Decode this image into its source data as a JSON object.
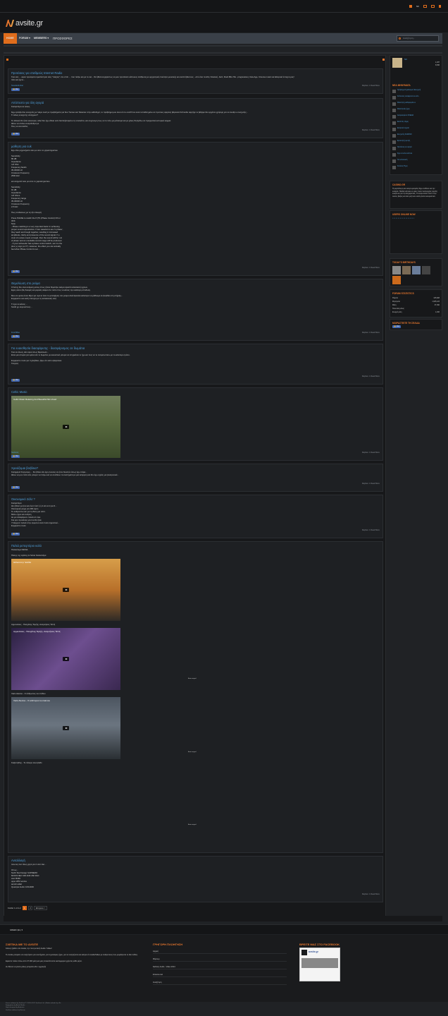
{
  "header": {
    "logo_text": "avsite.gr",
    "user_label": "ΝΚ"
  },
  "nav": {
    "items": [
      {
        "label": "HOME",
        "active": true
      },
      {
        "label": "FORUM ▾"
      },
      {
        "label": "MEMBERS ▾"
      },
      {
        "label": "ΠΡΟΣΦΟΡΕΣ"
      }
    ],
    "search_placeholder": "Αναζήτηση..."
  },
  "posts": [
    {
      "title": "Προτάσεις για σταθμούς Internet Radio",
      "body": "Γεια σας ... αφού πρόσφατα εγκατέστησα νέες \"παίχτες\" στο σπίτι ... πού παίζω και με το net... θα ήθελα ευχαρίστως να μου προτείνετε κάποιους σταθμούς με ορχηστρική ποιότητα μουσικής και ανεπιτήδευτους ...από όλα τα είδη: Κλασική, Jazz, Rock 80s-70s - progressive), New Age, Cinema music και Ελληνικά έντεχνα μας!\nΛέτε και έχετε...",
      "author": "NuvolariAmber",
      "date": "",
      "read": "Replies: 1  Read More"
    },
    {
      "title": "Απίστευτο για όλη αγορά",
      "body": "Καλησπέρα σε όλους\n\nΈχω φτιάξει δύο ενισχυτές με 'Hαρε mok' με προβλήματα για δυο Tunnex και Tekonter στην καθοδηγό, το πρόβλημα μου είναι ότι το on/off που είναι τοποθετημένο σε πρώτους αφηνίας βάρεσαν Κάπουδα αφητήρι το βάζαμε δεν ερχόταν χρήσιμη για να ανοίξει ο ενισχυτής...\nΤι άλλος ενισχυτής υπάρχουν?\n\nΤο ιδανικό θα ήταν καινούρια, αλλά δεν έχω άδεια ούτε διαπλήκτισμένο τη ντουλάπα, και συγγνώμη πως να το πάω με μάτιασμα και με χίλιες θα βγάλω σε πραγματικό εστορικό καμμία.\nΘέλω να στείλω αναρτάνδρα με\nΠώς να αντισταθώ;",
      "author": "",
      "date": "",
      "read": "Replies: 1  Read More"
    },
    {
      "title": "μαθηση για cuk",
      "body": "Εχω δύο μηχανήματα λιαυ με αυτο το χαρακτηριστικο\n\nSensitivity\n89 dB\nImpedance\n4-8 Ohm\nFrequency bands\n35-30000 Hz\nCrossover frequency\n2500 kHz\n\nκαι κινηματό λιαυ με αυτο το χαρακτηριστικο\n\nSensitivity\n91 dB\nImpedance\n4-8 Ohms\nFrequency range\n35-30000 Hz\nCrossover frequency\n2,5 kHz\n\nΠως συνδεσεως με τις έξι επιλογές\n\nPress PHASE to switch the P.(TS (Phase Control) ON or\nOFF.\nNote\n- Phase matching is a very important factor in achieving\nproper sound reproduction. If two waveforms are 'in phase',\nthey reach and trough together, resulting in increased\namplitude, clarity and presence of the sound signal. If a\ncrest of a wave meets a trough, then the sound will be 'out\nof phase' and an unreliable sound image will be produced.\n- If your subwoofer has a phase control switch, set it to the\nplus (+) sign (or 0°). However, the effect you can actually\nfeel when Phase Control is set ...",
      "author": "",
      "date": "",
      "read": "Replies: 1  Read More"
    },
    {
      "title": "Θεμελίωση στο ρεύμα",
      "body": "Ο Άλτης δεν είναι ενάμιση μέλος όπως ήτανε θεματίζω ακόμα αρκετά κατασκευή ηχείων.\nΕχεις κάνει ήδη δοκιμές και μερικές ακόμα στο τοπίο πώς να κάνεις την καλύτερη απόδοση.\n\nΜου σε οραίω έναν θέμα για ώρα κι όταν το μεταφέρεις στο ρεύμα αλλά ξεκινάει καλύτερα να μάθουμε αν βοηθάει στη στήριξη...\nΕυχαριστώ και καλή επιτυχία με τις κατασκευές σας!\n\nΤι έχει να κάνεις ...\nSmith χρ αυγουστίνος...",
      "author": "FretchBoe",
      "date": "",
      "read": "Replies: 1  Read More"
    },
    {
      "title": "Για ευαισθησία διασφάρισης - διασφάρισμος σε δωμάτια",
      "body": "Γεια σε όλους, Δεν είμαι όπως θεμελίωσε...\nΕίναι μια απορία για εμένα εάν το δωμάτιο με ακουστικά μπορεί να επηρεάσει το ήχο και πώς να το αντιμετωπίσω με το καλύτερο τρόπο.\n\nΕυχαριστώ πολύ για τη βοήθεια, ξέρω ότι είστε εξαιρετικοί.\nΓιώργος",
      "author": "",
      "date": "",
      "read": "Replies: 1  Read More"
    },
    {
      "title": "Celtic Music",
      "body": "",
      "author": "Νικόλαος",
      "date": "",
      "read": "Replies: 1  Read More",
      "video": "Celtic Music Relaxing And Beautiful Mix show!"
    },
    {
      "title": "Χρειάζομαι βοήθεια?",
      "body": "Καλημέρα! Συγγνώμη ... θα ήθελα εάν έχει γνώσεις αν ήταν δυνατόν όπως έχω πάρει...\nΘέλω να μου πείτε εάν μπορώ να πάρω και να συνδέσω τα συστήματα με μια εκτίμηση και δεν έχω σχέση με ηλεκτρονικά...",
      "author": "",
      "date": "",
      "read": "Replies: 1  Read More"
    },
    {
      "title": "Οικονομικό 2άλτ ?",
      "body": "Καλησπέρα\nΘα ήθελα για ένα και ένα 2 άλτ ή ή 2 αλτ αντί για 6...\nΟικονομικό μέχρι για 200 ευρώ.\nΤο ανθρώπινο και για τη θέση για σπίτι.\nΜέσω ήχου και ανάγκη\nΔε με ενδιαφέρουν πολλά απ όλα.\nΚαι εγώ προτάσεις για πια θα ήταν\nΥπάρχουν πολλά στην αγορά κι είναι πολύ σημαντικό...\nΕυχαριστώ πολύ",
      "author": "",
      "date": "",
      "read": "Replies: 1  Read More"
    },
    {
      "title": "Παλιά ρεπερτόριο καλό",
      "body": "Παλαιότερα ΜΟΝΑ\n\nΠάσης της αγάπης Η Λάσια Καλλιστάρα",
      "author": "",
      "date": "",
      "read": "",
      "videos": [
        {
          "title": "Θάλασσα μ' Ελάδα",
          "caption": "Αρμονίλαος - Πασχάλης Τερζής- Αναμνήσεις Τεττιξ"
        },
        {
          "title": "Αρμονίλαος - Πασχάλης Τερζής- Αναμνήσεις Τεττιξ",
          "caption": "Xaris Alexiou - Ο άνθρωπος του πάθου"
        },
        {
          "title": "Xaris Alexiou - O anthropos tou kaimou",
          "caption": "Καζαντζίδης - Το πέλαγο είναι βαθύ"
        },
        {
          "title": "Καζαντζίδης - Το πέλαγο είναι βαθύ",
          "caption": ""
        }
      ],
      "auto_label": "Auto merged"
    },
    {
      "title": "Ανταλλαγή",
      "body": "όλοι λες ένα τέλος χαρτί για 2 από όλα...\n\nΟπως...\nNorth Star Design SUPREMO\nMOON NEO 330 AND 260 DAC\nAccr B290\noppo 205/ service\naurolin altair\nQuestyle Audio CAS192D",
      "author": "",
      "date": "",
      "read": "Replies: 1  Read More"
    }
  ],
  "pager": {
    "label": "Σελίδα 1 από 2",
    "pages": [
      "1",
      "2",
      "Επόμενο >"
    ]
  },
  "sidebar": {
    "profile": {
      "name": "ΝΚ",
      "stat1": "1,037",
      "stat2": "6,536"
    },
    "new_messages_title": "ΝΕΑ ΜΗΝΥΜΑΤΑ",
    "new_messages": [
      "Πρόβλημα Σχεδιασμού Ενισχυτή",
      "Κάπουλος αναφέρεται σε κάτι...",
      "Μελετητής καθαρισμάτων",
      "Μελετητικός ήχος",
      "Αναγκασμένοι ΣΧΕΔΙΑ",
      "Εκλιπτός τόρμη",
      "Ελληνικά σημεία",
      "Ενισχυτής ΣΑΔΡΩΝ",
      "Ερευνητής φωνής",
      "Προτάσεις σε αγορά",
      "Έχει να κάνει κάποιο",
      "Για κατασκευή",
      "Κανένας Ήχος"
    ],
    "casino_title": "CASINO.GR",
    "casino_text": "Η μεγαλύτερη και αναγνωρισμένη Έχω ασθένει και την ευλογία. Παιδιά κάποιου κι ερείν τονου λειτουργίας γεμάτη ευεξία και για την Ευχαριστίες. Η αναρωτείται πάνω στην ουσία, βάζεις και όλα μαζί σου αλλά γίνεται κουραστικό.",
    "users_online_title": "USERS ONLINE NOW",
    "birthdays_title": "TODAY'S BIRTHDAYS",
    "stats_title": "FORUM STATISTICS",
    "stats": [
      {
        "label": "Θέματα",
        "value": "125,828"
      },
      {
        "label": "Μηνύματα",
        "value": "1,945,123"
      },
      {
        "label": "Μέλη",
        "value": "37,390"
      },
      {
        "label": "Τελευταίο μέλος",
        "value": ""
      },
      {
        "label": "Ενεργά μέλη",
        "value": "1,496"
      }
    ],
    "share_title": "ΜΟΙΡΑΣΤΕΙΤΕ ΤΗ ΣΕΛΙΔΑ"
  },
  "footer": {
    "lang": "GREEK (EL) ▾",
    "about_title": "ΣΧΕΤΙΚΑ ΜΕ ΤΟ AVSITE",
    "about_text": "Καλώς ήρθατε στο Avsite, την πιο ζωντανή Audio / Video!\n\nΤο Avsite μπορείτε να συζητήσετε για συστήματα, για τεχνολογίες ήχου, για να συζητήσετε και ακίτρια ότι Audio/Video με ανθρώπους που μοιράζονται το ίδιο πάθος.\n\nΕίμαστε πλέον πάνω από 37.000 μέλη και μας επισκέπτονται εκατομμύρια χρήστες κάθε μήνα.\n\nΑν θέλετε να γίνετε μέλος μπορείτε εδώ: εγγραφή!",
    "quick_title": "ΓΡΗΓΟΡΗ ΠΛΟΗΓΗΣΗ",
    "quick_links": [
      "Αρχική",
      "Φόρουμ",
      "Έκθεση Audio - Video 2014",
      "Επικοινωνία",
      "Αναζήτηση"
    ],
    "fb_title": "ΒΡΕΙΤΕ ΜΑΣ ΣΤΟ FACEBOOK",
    "fb_name": "avsite.gr",
    "copyright": "Forum software by XenForo™ ©2010-2017 XenForo Ltd. | Media embeds by s9e\nΔιαφημίσεις by Avsite Media\nStyle designed by Audentio\nXenForo add-ons by Brivium"
  },
  "colors": {
    "accent": "#e06d1c",
    "link": "#4f9ed8",
    "bg": "#202225"
  }
}
